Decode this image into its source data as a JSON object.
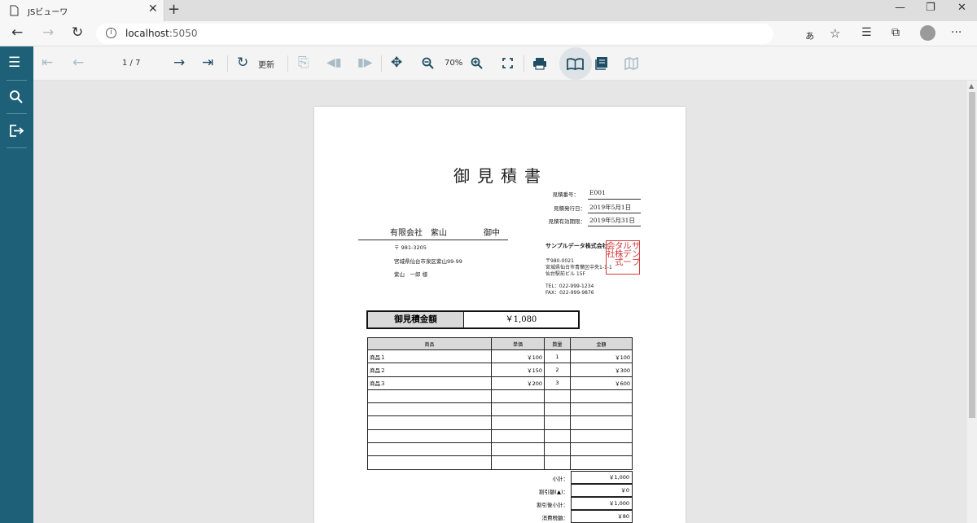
{
  "browser": {
    "tab_title": "JSビューワ",
    "tab_close": "✕",
    "new_tab": "+",
    "url_host": "localhost",
    "url_port": ":5050"
  },
  "toolbar": {
    "page_indicator": "1 / 7",
    "refresh_label": "更新",
    "zoom_label": "70%"
  },
  "document": {
    "title": "御見積書",
    "quote_no_label": "見積番号：",
    "quote_no": "E001",
    "issue_date_label": "見積発行日：",
    "issue_date": "2019年5月1日",
    "expiry_label": "見積有効期限：",
    "expiry_date": "2019年5月31日",
    "recipient_company": "有限会社　紫山",
    "recipient_suffix": "御中",
    "recipient_postal": "〒 981-3205",
    "recipient_address": "宮城県仙台市泉区紫山99-99",
    "recipient_person": "紫山　一郎 様",
    "issuer_company": "サンプルデータ株式会社",
    "issuer_postal": "〒980-0021",
    "issuer_address1": "宮城県仙台市青葉区中央1-1-1",
    "issuer_address2": "仙台駅前ビル 15F",
    "issuer_tel": "TEL：022-999-1234",
    "issuer_fax": "FAX：022-999-9876",
    "seal_text": "サンプルデータ株式会社",
    "total_label": "御見積金額",
    "total_value": "￥1,080",
    "table_headers": [
      "商品",
      "単価",
      "数量",
      "金額"
    ],
    "rows": [
      {
        "product": "商品１",
        "unit_price": "￥100",
        "qty": "1",
        "amount": "￥100"
      },
      {
        "product": "商品２",
        "unit_price": "￥150",
        "qty": "2",
        "amount": "￥300"
      },
      {
        "product": "商品３",
        "unit_price": "￥200",
        "qty": "3",
        "amount": "￥600"
      }
    ],
    "subtotal_label": "小計：",
    "subtotal": "￥1,000",
    "discount_label": "割引額(▲)：",
    "discount": "￥0",
    "after_discount_label": "割引後小計：",
    "after_discount": "￥1,000",
    "tax_label": "消費税額：",
    "tax": "￥80"
  },
  "icons": {
    "accent": "#1d6077"
  }
}
